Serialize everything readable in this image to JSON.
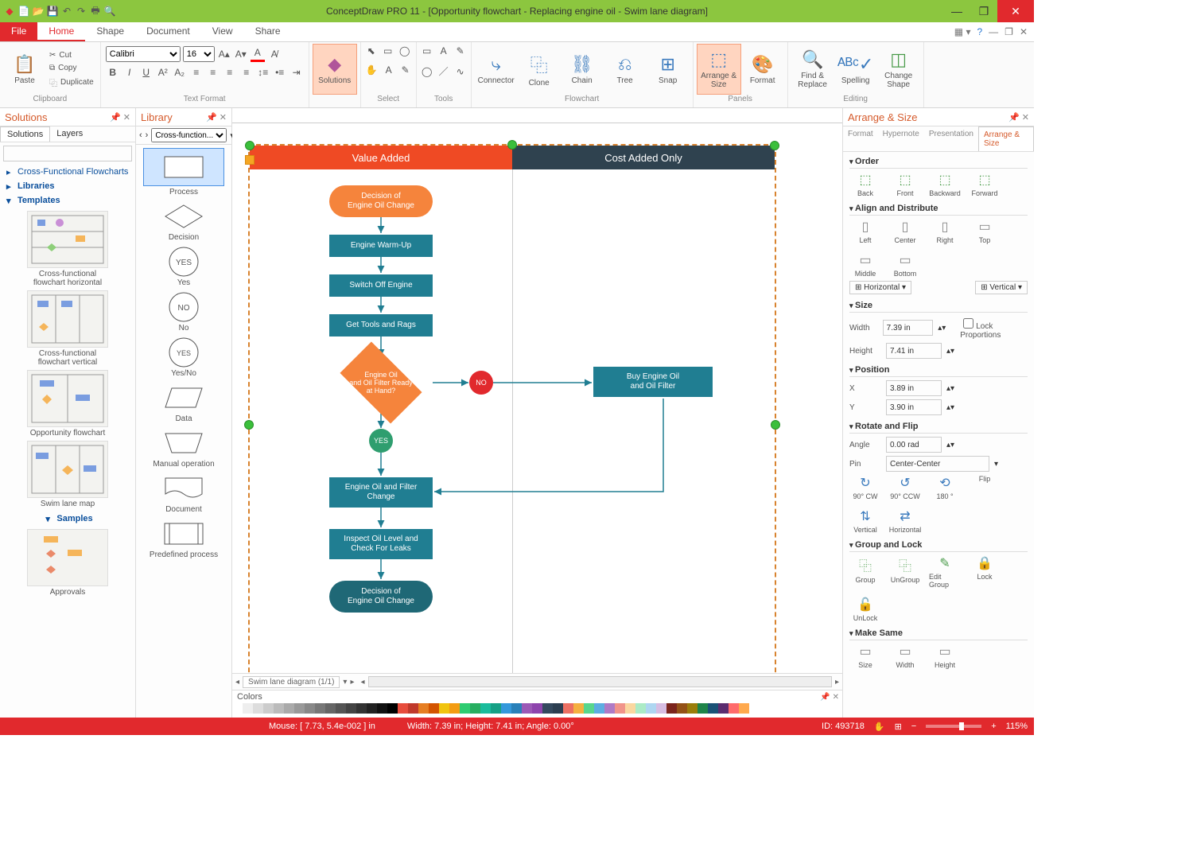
{
  "title": "ConceptDraw PRO 11 - [Opportunity flowchart - Replacing engine oil - Swim lane diagram]",
  "tabs": {
    "file": "File",
    "home": "Home",
    "shape": "Shape",
    "document": "Document",
    "view": "View",
    "share": "Share"
  },
  "ribbon": {
    "paste": "Paste",
    "cut": "Cut",
    "copy": "Copy",
    "duplicate": "Duplicate",
    "clipboard": "Clipboard",
    "font": "Calibri",
    "size": "16",
    "textformat": "Text Format",
    "solutions": "Solutions",
    "select": "Select",
    "tools": "Tools",
    "connector": "Connector",
    "clone": "Clone",
    "chain": "Chain",
    "tree": "Tree",
    "snap": "Snap",
    "flowchart": "Flowchart",
    "arrange": "Arrange & Size",
    "format": "Format",
    "panels": "Panels",
    "findreplace": "Find & Replace",
    "spelling": "Spelling",
    "changeshape": "Change Shape",
    "editing": "Editing"
  },
  "solutions": {
    "title": "Solutions",
    "tab1": "Solutions",
    "tab2": "Layers",
    "cff": "Cross-Functional Flowcharts",
    "libraries": "Libraries",
    "templates": "Templates",
    "samples": "Samples",
    "tpl1": "Cross-functional flowchart horizontal",
    "tpl2": "Cross-functional flowchart vertical",
    "tpl3": "Opportunity flowchart",
    "tpl4": "Swim lane map",
    "tpl5": "Approvals"
  },
  "library": {
    "title": "Library",
    "combo": "Cross-function...",
    "s1": "Process",
    "s2": "Decision",
    "s3": "Yes",
    "s4": "No",
    "s5": "Yes/No",
    "s6": "Data",
    "s7": "Manual operation",
    "s8": "Document",
    "s9": "Predefined process"
  },
  "canvas": {
    "lane1": "Value Added",
    "lane2": "Cost Added Only",
    "n1": "Decision of\nEngine Oil Change",
    "n2": "Engine Warm-Up",
    "n3": "Switch Off Engine",
    "n4": "Get Tools and Rags",
    "n5": "Engine Oil\nand Oil Filter Ready\nat Hand?",
    "no": "NO",
    "yes": "YES",
    "n6": "Buy Engine Oil\nand Oil Filter",
    "n7": "Engine Oil and Filter\nChange",
    "n8": "Inspect Oil Level and\nCheck For Leaks",
    "n9": "Decision of\nEngine Oil Change",
    "pagetab": "Swim lane diagram (1/1)"
  },
  "colors": "Colors",
  "arrange": {
    "title": "Arrange & Size",
    "tabs": {
      "format": "Format",
      "hypernote": "Hypernote",
      "presentation": "Presentation",
      "active": "Arrange & Size"
    },
    "order": "Order",
    "back": "Back",
    "front": "Front",
    "backward": "Backward",
    "forward": "Forward",
    "align": "Align and Distribute",
    "left": "Left",
    "center": "Center",
    "rightl": "Right",
    "top": "Top",
    "middle": "Middle",
    "bottom": "Bottom",
    "horizontal": "Horizontal",
    "vertical": "Vertical",
    "size": "Size",
    "width": "Width",
    "widthv": "7.39 in",
    "height": "Height",
    "heightv": "7.41 in",
    "lock": "Lock Proportions",
    "position": "Position",
    "x": "X",
    "xv": "3.89 in",
    "y": "Y",
    "yv": "3.90 in",
    "rotate": "Rotate and Flip",
    "angle": "Angle",
    "anglev": "0.00 rad",
    "pin": "Pin",
    "pinv": "Center-Center",
    "r1": "90° CW",
    "r2": "90° CCW",
    "r3": "180 °",
    "flip": "Flip",
    "fv": "Vertical",
    "fh": "Horizontal",
    "group": "Group and Lock",
    "g1": "Group",
    "g2": "UnGroup",
    "g3": "Edit Group",
    "g4": "Lock",
    "g5": "UnLock",
    "make": "Make Same",
    "m1": "Size",
    "m2": "Width",
    "m3": "Height"
  },
  "status": {
    "mouse": "Mouse: [ 7.73, 5.4e-002 ] in",
    "dims": "Width: 7.39 in;  Height: 7.41 in;  Angle: 0.00°",
    "id": "ID: 493718",
    "zoom": "115%"
  }
}
